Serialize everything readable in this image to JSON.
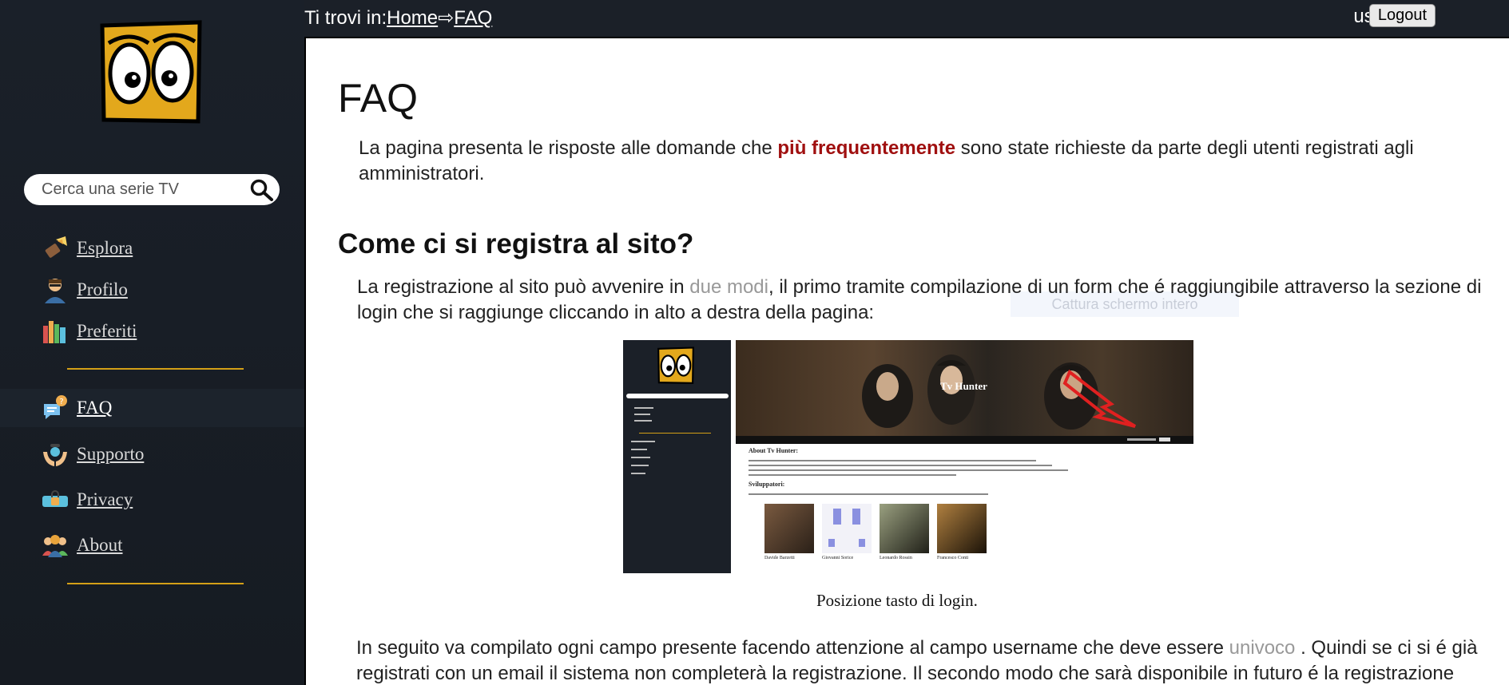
{
  "sidebar": {
    "search_placeholder": "Cerca una serie TV",
    "items": [
      {
        "label": "Esplora",
        "icon": "flashlight-icon"
      },
      {
        "label": "Profilo",
        "icon": "user-icon"
      },
      {
        "label": "Preferiti",
        "icon": "books-icon"
      },
      {
        "label": "FAQ",
        "icon": "faq-chat-icon",
        "active": true
      },
      {
        "label": "Supporto",
        "icon": "support-hands-icon"
      },
      {
        "label": "Privacy",
        "icon": "privacy-lock-icon"
      },
      {
        "label": "About",
        "icon": "team-icon"
      }
    ],
    "accent_color": "#d4a017"
  },
  "topbar": {
    "prefix": "Ti trovi in:",
    "crumb_home": "Home",
    "separator": "⇨",
    "crumb_current": "FAQ",
    "user": "user",
    "logout_label": "Logout"
  },
  "main": {
    "title": "FAQ",
    "intro_before": "La pagina presenta le risposte alle domande che ",
    "intro_highlight": "più frequentemente",
    "intro_after": " sono state richieste da parte degli utenti registrati agli amministratori.",
    "section_title": "Come ci si registra al sito?",
    "p1_before": "La registrazione al sito può avvenire in ",
    "p1_faint": "due modi",
    "p1_after": ", il primo tramite compilazione di un form che é raggiungibile attraverso la sezione di login che si raggiunge cliccando in alto a destra della pagina:",
    "ghost_tooltip": "Cattura schermo intero",
    "figure_caption": "Posizione tasto di login.",
    "p2_before": "In seguito va compilato ogni campo presente facendo attenzione al campo username che deve essere ",
    "p2_faint": "univoco",
    "p2_after": " . Quindi se ci si é già registrati con un email il sistema non completerà la registrazione. Il secondo modo che sarà disponibile in futuro é la registrazione",
    "highlight_color": "#a01010"
  },
  "figure": {
    "hero_title": "Tv Hunter",
    "about_heading": "About Tv Hunter:",
    "dev_heading": "Sviluppatori:",
    "devs": [
      "Davide Barzetti",
      "Giovanni Sorice",
      "Leonardo Rossin",
      "Francesco Conti"
    ]
  }
}
